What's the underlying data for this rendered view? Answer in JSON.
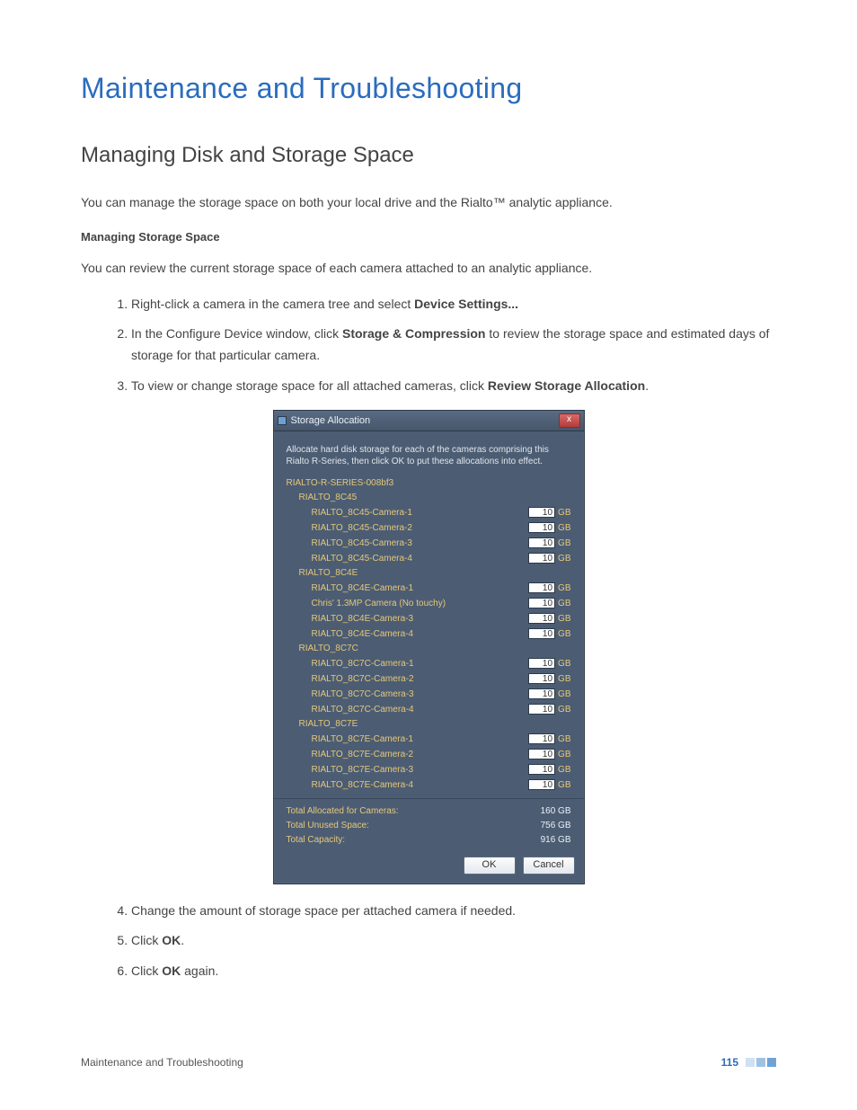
{
  "heading": "Maintenance and Troubleshooting",
  "subheading": "Managing Disk and Storage Space",
  "intro_before_tm": "You can manage the storage space on both your local drive and the Rialto",
  "intro_after_tm": " analytic appliance.",
  "section_title": "Managing Storage Space",
  "section_para": "You can review the current storage space of each camera attached to an analytic appliance.",
  "steps": {
    "s1a": "Right-click a camera in the camera tree and select ",
    "s1b": "Device Settings...",
    "s2a": "In the Configure Device window, click ",
    "s2b": "Storage & Compression",
    "s2c": " to review the storage space and estimated days of storage for that particular camera.",
    "s3a": "To view or change storage space for all attached cameras, click ",
    "s3b": "Review Storage Allocation",
    "s3c": ".",
    "s4": "Change the amount of storage space per attached camera if needed.",
    "s5a": "Click ",
    "s5b": "OK",
    "s5c": ".",
    "s6a": "Click ",
    "s6b": "OK",
    "s6c": " again."
  },
  "dialog": {
    "title": "Storage Allocation",
    "close": "x",
    "description": "Allocate hard disk storage for each of the cameras comprising this Rialto R-Series, then click OK to put these allocations into effect.",
    "root": "RIALTO-R-SERIES-008bf3",
    "groups": [
      {
        "name": "RIALTO_8C45",
        "cameras": [
          {
            "name": "RIALTO_8C45-Camera-1",
            "value": "10",
            "unit": "GB"
          },
          {
            "name": "RIALTO_8C45-Camera-2",
            "value": "10",
            "unit": "GB"
          },
          {
            "name": "RIALTO_8C45-Camera-3",
            "value": "10",
            "unit": "GB"
          },
          {
            "name": "RIALTO_8C45-Camera-4",
            "value": "10",
            "unit": "GB"
          }
        ]
      },
      {
        "name": "RIALTO_8C4E",
        "cameras": [
          {
            "name": "RIALTO_8C4E-Camera-1",
            "value": "10",
            "unit": "GB"
          },
          {
            "name": "Chris' 1.3MP Camera (No touchy)",
            "value": "10",
            "unit": "GB"
          },
          {
            "name": "RIALTO_8C4E-Camera-3",
            "value": "10",
            "unit": "GB"
          },
          {
            "name": "RIALTO_8C4E-Camera-4",
            "value": "10",
            "unit": "GB"
          }
        ]
      },
      {
        "name": "RIALTO_8C7C",
        "cameras": [
          {
            "name": "RIALTO_8C7C-Camera-1",
            "value": "10",
            "unit": "GB"
          },
          {
            "name": "RIALTO_8C7C-Camera-2",
            "value": "10",
            "unit": "GB"
          },
          {
            "name": "RIALTO_8C7C-Camera-3",
            "value": "10",
            "unit": "GB"
          },
          {
            "name": "RIALTO_8C7C-Camera-4",
            "value": "10",
            "unit": "GB"
          }
        ]
      },
      {
        "name": "RIALTO_8C7E",
        "cameras": [
          {
            "name": "RIALTO_8C7E-Camera-1",
            "value": "10",
            "unit": "GB"
          },
          {
            "name": "RIALTO_8C7E-Camera-2",
            "value": "10",
            "unit": "GB"
          },
          {
            "name": "RIALTO_8C7E-Camera-3",
            "value": "10",
            "unit": "GB"
          },
          {
            "name": "RIALTO_8C7E-Camera-4",
            "value": "10",
            "unit": "GB"
          }
        ]
      }
    ],
    "totals": [
      {
        "label": "Total Allocated for Cameras:",
        "value": "160 GB"
      },
      {
        "label": "Total Unused Space:",
        "value": "756 GB"
      },
      {
        "label": "Total Capacity:",
        "value": "916 GB"
      }
    ],
    "ok": "OK",
    "cancel": "Cancel"
  },
  "footer_left": "Maintenance and Troubleshooting",
  "page_number": "115"
}
